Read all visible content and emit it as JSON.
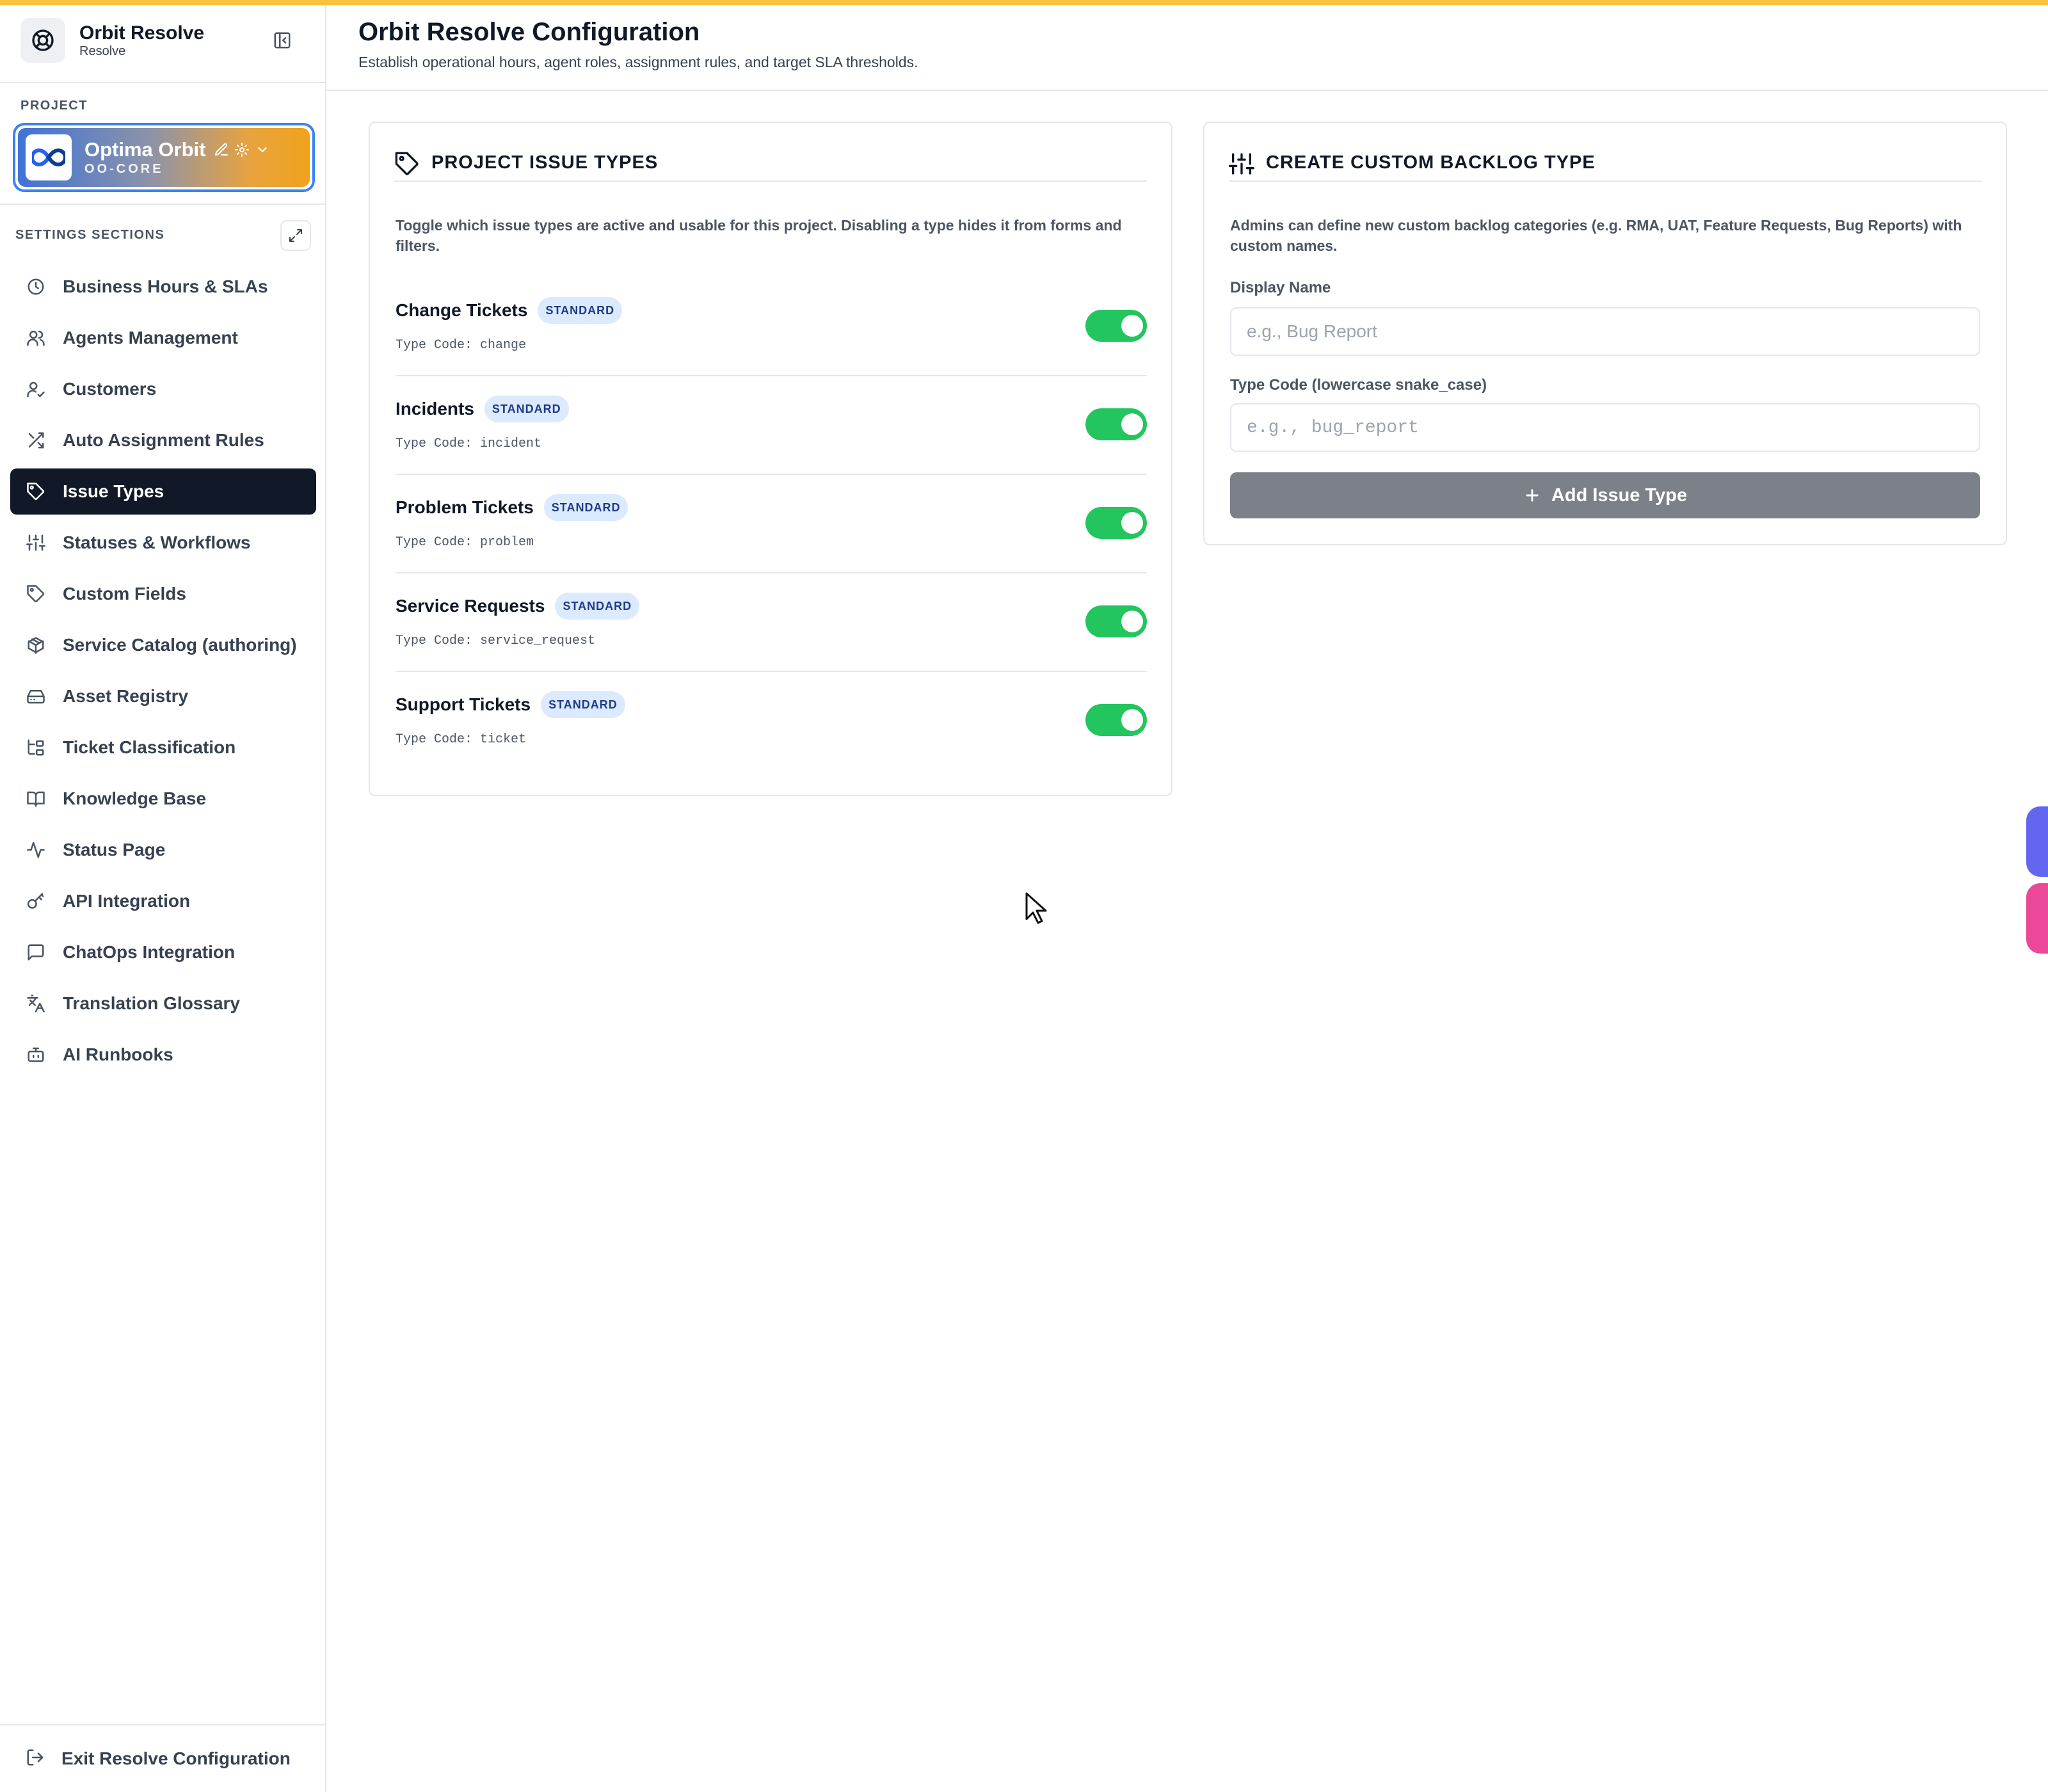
{
  "app": {
    "title": "Orbit Resolve",
    "subtitle": "Resolve"
  },
  "sidebar": {
    "project_label": "PROJECT",
    "project": {
      "name": "Optima Orbit",
      "code": "OO-CORE"
    },
    "settings_label": "SETTINGS SECTIONS",
    "items": [
      {
        "label": "Business Hours & SLAs",
        "icon": "clock-icon"
      },
      {
        "label": "Agents Management",
        "icon": "users-icon"
      },
      {
        "label": "Customers",
        "icon": "user-check-icon"
      },
      {
        "label": "Auto Assignment Rules",
        "icon": "shuffle-icon"
      },
      {
        "label": "Issue Types",
        "icon": "tag-icon",
        "active": true
      },
      {
        "label": "Statuses & Workflows",
        "icon": "sliders-icon"
      },
      {
        "label": "Custom Fields",
        "icon": "tag-icon"
      },
      {
        "label": "Service Catalog (authoring)",
        "icon": "package-icon"
      },
      {
        "label": "Asset Registry",
        "icon": "hard-drive-icon"
      },
      {
        "label": "Ticket Classification",
        "icon": "folder-tree-icon"
      },
      {
        "label": "Knowledge Base",
        "icon": "book-icon"
      },
      {
        "label": "Status Page",
        "icon": "activity-icon"
      },
      {
        "label": "API Integration",
        "icon": "key-icon"
      },
      {
        "label": "ChatOps Integration",
        "icon": "message-square-icon"
      },
      {
        "label": "Translation Glossary",
        "icon": "languages-icon"
      },
      {
        "label": "AI Runbooks",
        "icon": "bot-icon"
      }
    ],
    "exit_label": "Exit Resolve Configuration"
  },
  "header": {
    "title": "Orbit Resolve Configuration",
    "subtitle": "Establish operational hours, agent roles, assignment rules, and target SLA thresholds."
  },
  "issue_types": {
    "title": "PROJECT ISSUE TYPES",
    "description": "Toggle which issue types are active and usable for this project. Disabling a type hides it from forms and filters.",
    "code_prefix": "Type Code: ",
    "items": [
      {
        "name": "Change Tickets",
        "badge": "STANDARD",
        "code_line": "Type Code: change",
        "enabled": true
      },
      {
        "name": "Incidents",
        "badge": "STANDARD",
        "code_line": "Type Code: incident",
        "enabled": true
      },
      {
        "name": "Problem Tickets",
        "badge": "STANDARD",
        "code_line": "Type Code: problem",
        "enabled": true
      },
      {
        "name": "Service Requests",
        "badge": "STANDARD",
        "code_line": "Type Code: service_request",
        "enabled": true
      },
      {
        "name": "Support Tickets",
        "badge": "STANDARD",
        "code_line": "Type Code: ticket",
        "enabled": true
      }
    ]
  },
  "custom_type": {
    "title": "CREATE CUSTOM BACKLOG TYPE",
    "description": "Admins can define new custom backlog categories (e.g. RMA, UAT, Feature Requests, Bug Reports) with custom names.",
    "display_name_label": "Display Name",
    "display_name_placeholder": "e.g., Bug Report",
    "display_name_value": "",
    "type_code_label": "Type Code (lowercase snake_case)",
    "type_code_placeholder": "e.g., bug_report",
    "type_code_value": "",
    "add_button_label": "Add Issue Type"
  },
  "colors": {
    "accent_bar": "#f9c23c",
    "active_nav": "#111827",
    "toggle_on": "#22c55e",
    "badge_bg": "#dbeafe",
    "button_disabled": "#7c8089",
    "float_button_1": "#6366f1",
    "float_button_2": "#ec4899"
  }
}
